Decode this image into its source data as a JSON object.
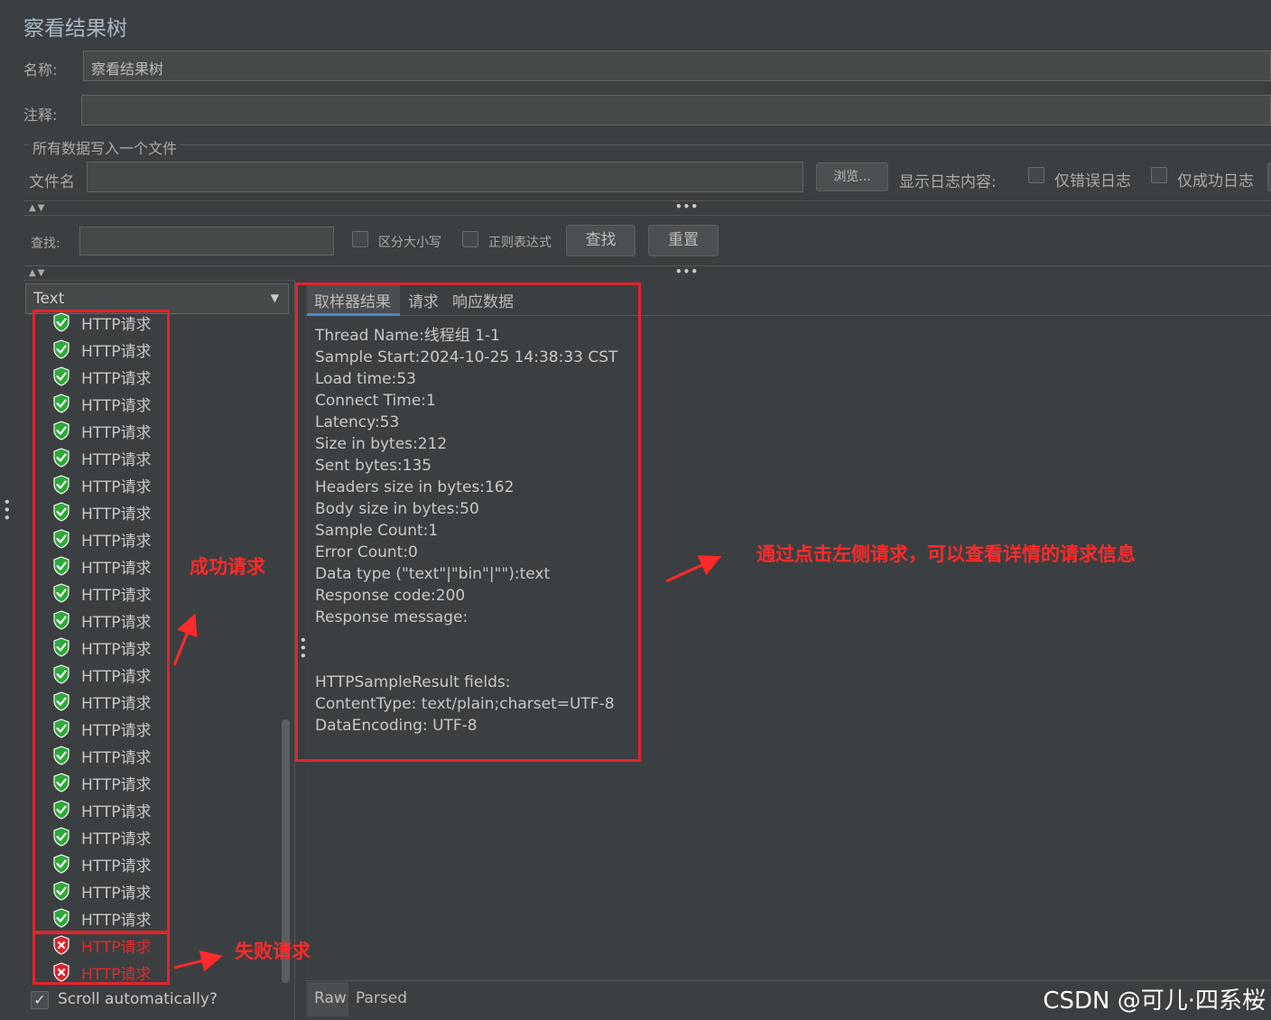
{
  "title": "察看结果树",
  "name_label": "名称:",
  "name_value": "察看结果树",
  "comment_label": "注释:",
  "file_section_label": "所有数据写入一个文件",
  "filename_label": "文件名",
  "browse_label": "浏览...",
  "log_display_label": "显示日志内容:",
  "errors_only_label": "仅错误日志",
  "success_only_label": "仅成功日志",
  "search_label": "查找:",
  "case_sensitive_label": "区分大小写",
  "regex_label": "正则表达式",
  "find_button": "查找",
  "reset_button": "重置",
  "renderer_select": "Text",
  "tree_items": [
    {
      "label": "HTTP请求",
      "status": "success"
    },
    {
      "label": "HTTP请求",
      "status": "success"
    },
    {
      "label": "HTTP请求",
      "status": "success"
    },
    {
      "label": "HTTP请求",
      "status": "success"
    },
    {
      "label": "HTTP请求",
      "status": "success"
    },
    {
      "label": "HTTP请求",
      "status": "success"
    },
    {
      "label": "HTTP请求",
      "status": "success"
    },
    {
      "label": "HTTP请求",
      "status": "success"
    },
    {
      "label": "HTTP请求",
      "status": "success"
    },
    {
      "label": "HTTP请求",
      "status": "success"
    },
    {
      "label": "HTTP请求",
      "status": "success"
    },
    {
      "label": "HTTP请求",
      "status": "success"
    },
    {
      "label": "HTTP请求",
      "status": "success"
    },
    {
      "label": "HTTP请求",
      "status": "success"
    },
    {
      "label": "HTTP请求",
      "status": "success"
    },
    {
      "label": "HTTP请求",
      "status": "success"
    },
    {
      "label": "HTTP请求",
      "status": "success"
    },
    {
      "label": "HTTP请求",
      "status": "success"
    },
    {
      "label": "HTTP请求",
      "status": "success"
    },
    {
      "label": "HTTP请求",
      "status": "success"
    },
    {
      "label": "HTTP请求",
      "status": "success"
    },
    {
      "label": "HTTP请求",
      "status": "success"
    },
    {
      "label": "HTTP请求",
      "status": "success"
    },
    {
      "label": "HTTP请求",
      "status": "failure"
    },
    {
      "label": "HTTP请求",
      "status": "failure"
    }
  ],
  "scroll_auto_label": "Scroll automatically?",
  "tabs": [
    "取样器结果",
    "请求",
    "响应数据"
  ],
  "result_lines": [
    "Thread Name:线程组 1-1",
    "Sample Start:2024-10-25 14:38:33 CST",
    "Load time:53",
    "Connect Time:1",
    "Latency:53",
    "Size in bytes:212",
    "Sent bytes:135",
    "Headers size in bytes:162",
    "Body size in bytes:50",
    "Sample Count:1",
    "Error Count:0",
    "Data type (\"text\"|\"bin\"|\"\"):text",
    "Response code:200",
    "Response message:",
    "",
    "",
    "HTTPSampleResult fields:",
    "ContentType: text/plain;charset=UTF-8",
    "DataEncoding: UTF-8"
  ],
  "bottom_tabs": [
    "Raw",
    "Parsed"
  ],
  "annotations": {
    "success": "成功请求",
    "failure": "失败请求",
    "detail": "通过点击左侧请求，可以查看详情的请求信息"
  },
  "watermark": "CSDN @可儿·四系桜",
  "colors": {
    "success_icon": "#2fa83a",
    "failure_icon": "#d6242b",
    "annotation": "#ff2a2a"
  }
}
